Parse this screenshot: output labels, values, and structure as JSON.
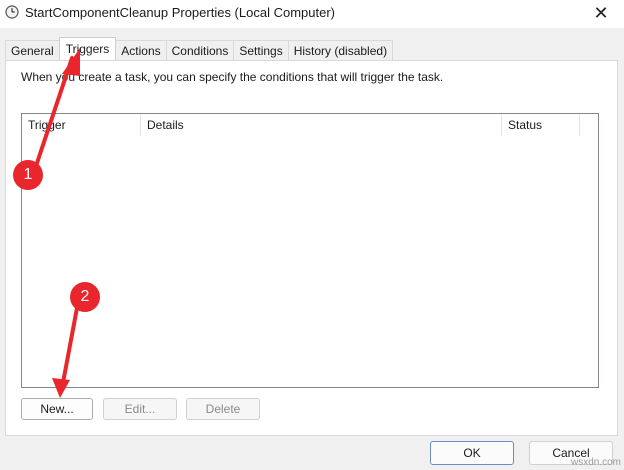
{
  "window": {
    "title": "StartComponentCleanup Properties (Local Computer)",
    "close_glyph": "✕",
    "icon": "clock-gear-icon"
  },
  "tabs": [
    {
      "label": "General",
      "active": false
    },
    {
      "label": "Triggers",
      "active": true
    },
    {
      "label": "Actions",
      "active": false
    },
    {
      "label": "Conditions",
      "active": false
    },
    {
      "label": "Settings",
      "active": false
    },
    {
      "label": "History (disabled)",
      "active": false
    }
  ],
  "triggers": {
    "info": "When you create a task, you can specify the conditions that will trigger the task.",
    "columns": [
      "Trigger",
      "Details",
      "Status"
    ],
    "rows": [],
    "buttons": {
      "new": "New...",
      "edit": "Edit...",
      "delete": "Delete"
    }
  },
  "footer": {
    "ok": "OK",
    "cancel": "Cancel"
  },
  "annotations": [
    {
      "label": "1",
      "color": "#e8262b"
    },
    {
      "label": "2",
      "color": "#e8262b"
    }
  ],
  "watermark": "wsxdn.com"
}
